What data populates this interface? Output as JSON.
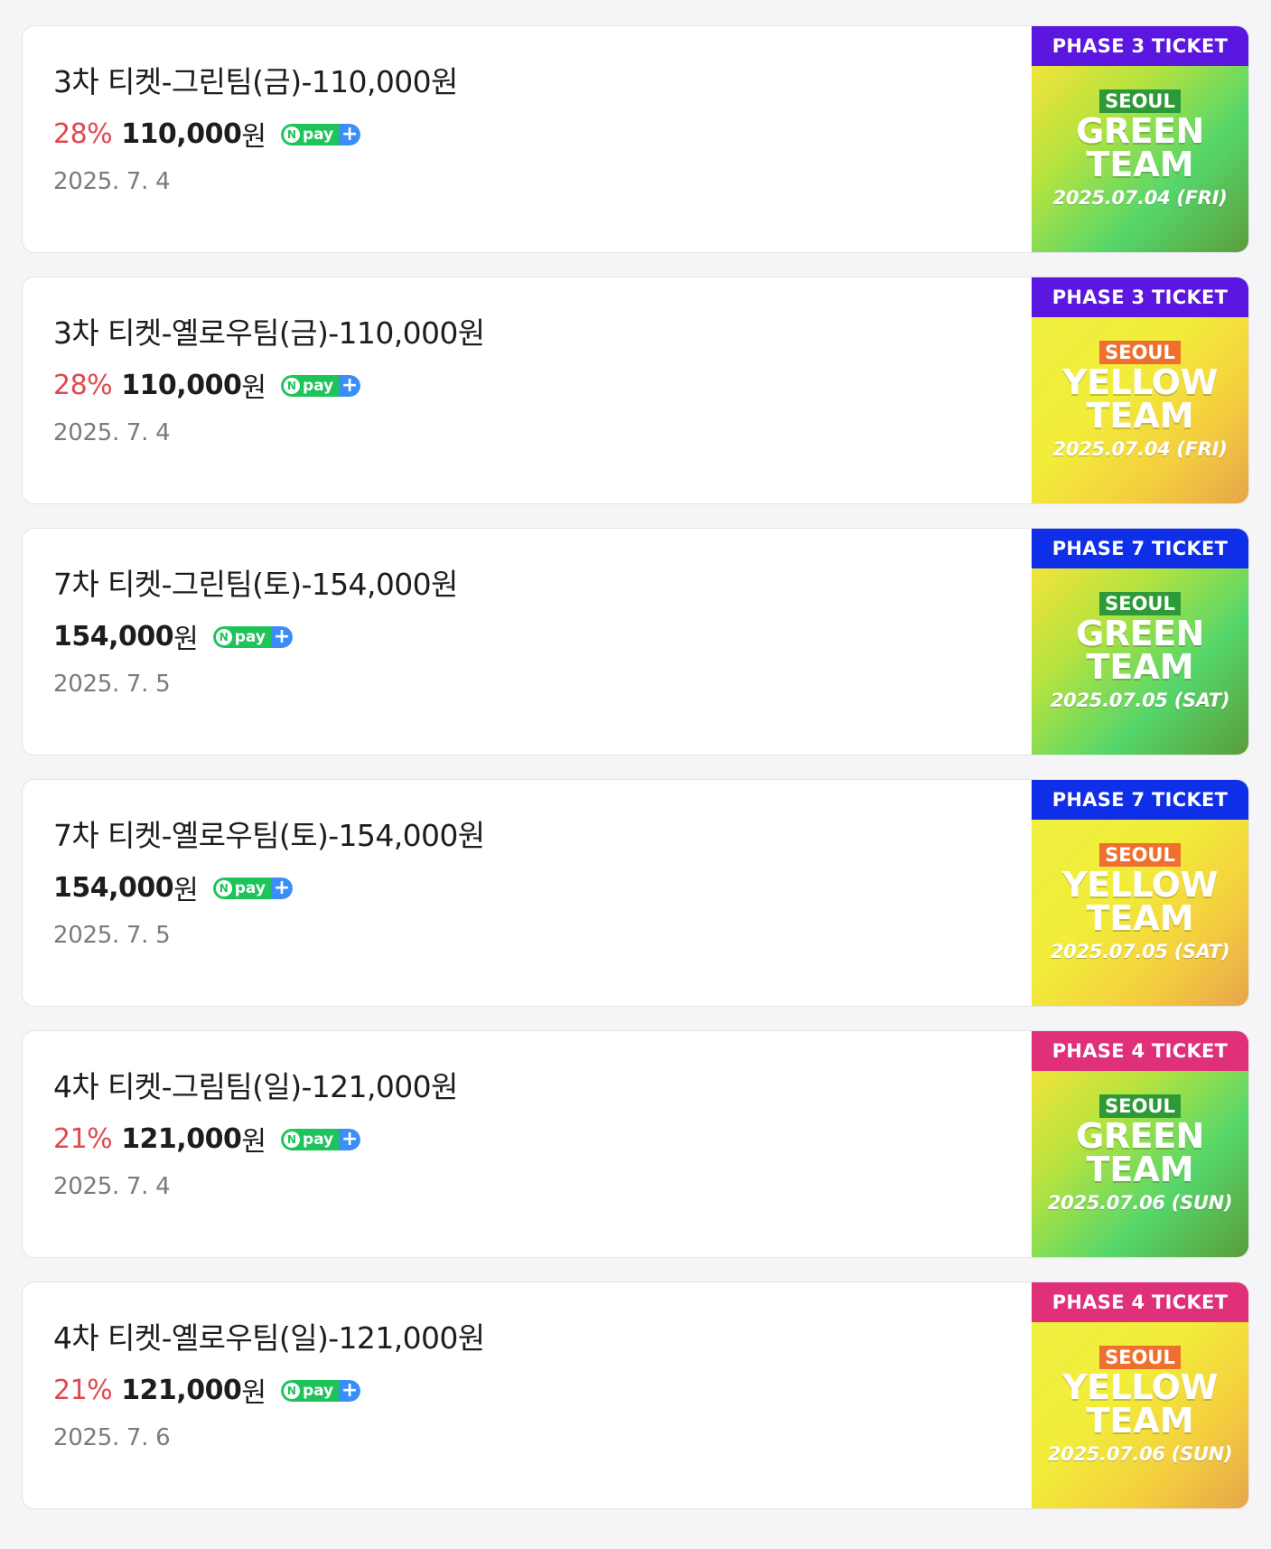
{
  "products": [
    {
      "title": "3차 티켓-그린팀(금)-110,000원",
      "discount": "28%",
      "price": "110,000",
      "currency": "원",
      "npay_label": "pay",
      "npay_plus": "+",
      "date": "2025. 7. 4",
      "thumb": {
        "phase": "PHASE 3 TICKET",
        "phase_color": "#5b16e0",
        "theme": "green",
        "city": "SEOUL",
        "team": "GREEN",
        "team_word": "TEAM",
        "date": "2025.07.04 (FRI)"
      }
    },
    {
      "title": "3차 티켓-옐로우팀(금)-110,000원",
      "discount": "28%",
      "price": "110,000",
      "currency": "원",
      "npay_label": "pay",
      "npay_plus": "+",
      "date": "2025. 7. 4",
      "thumb": {
        "phase": "PHASE 3 TICKET",
        "phase_color": "#5b16e0",
        "theme": "yellow",
        "city": "SEOUL",
        "team": "YELLOW",
        "team_word": "TEAM",
        "date": "2025.07.04 (FRI)"
      }
    },
    {
      "title": "7차 티켓-그린팀(토)-154,000원",
      "discount": "",
      "price": "154,000",
      "currency": "원",
      "npay_label": "pay",
      "npay_plus": "+",
      "date": "2025. 7. 5",
      "thumb": {
        "phase": "PHASE 7 TICKET",
        "phase_color": "#0f2ee8",
        "theme": "green",
        "city": "SEOUL",
        "team": "GREEN",
        "team_word": "TEAM",
        "date": "2025.07.05 (SAT)"
      }
    },
    {
      "title": "7차 티켓-옐로우팀(토)-154,000원",
      "discount": "",
      "price": "154,000",
      "currency": "원",
      "npay_label": "pay",
      "npay_plus": "+",
      "date": "2025. 7. 5",
      "thumb": {
        "phase": "PHASE 7 TICKET",
        "phase_color": "#0f2ee8",
        "theme": "yellow",
        "city": "SEOUL",
        "team": "YELLOW",
        "team_word": "TEAM",
        "date": "2025.07.05 (SAT)"
      }
    },
    {
      "title": "4차 티켓-그림팀(일)-121,000원",
      "discount": "21%",
      "price": "121,000",
      "currency": "원",
      "npay_label": "pay",
      "npay_plus": "+",
      "date": "2025. 7. 4",
      "thumb": {
        "phase": "PHASE 4 TICKET",
        "phase_color": "#e0307a",
        "theme": "green",
        "city": "SEOUL",
        "team": "GREEN",
        "team_word": "TEAM",
        "date": "2025.07.06 (SUN)"
      }
    },
    {
      "title": "4차 티켓-옐로우팀(일)-121,000원",
      "discount": "21%",
      "price": "121,000",
      "currency": "원",
      "npay_label": "pay",
      "npay_plus": "+",
      "date": "2025. 7. 6",
      "thumb": {
        "phase": "PHASE 4 TICKET",
        "phase_color": "#e0307a",
        "theme": "yellow",
        "city": "SEOUL",
        "team": "YELLOW",
        "team_word": "TEAM",
        "date": "2025.07.06 (SUN)"
      }
    }
  ]
}
